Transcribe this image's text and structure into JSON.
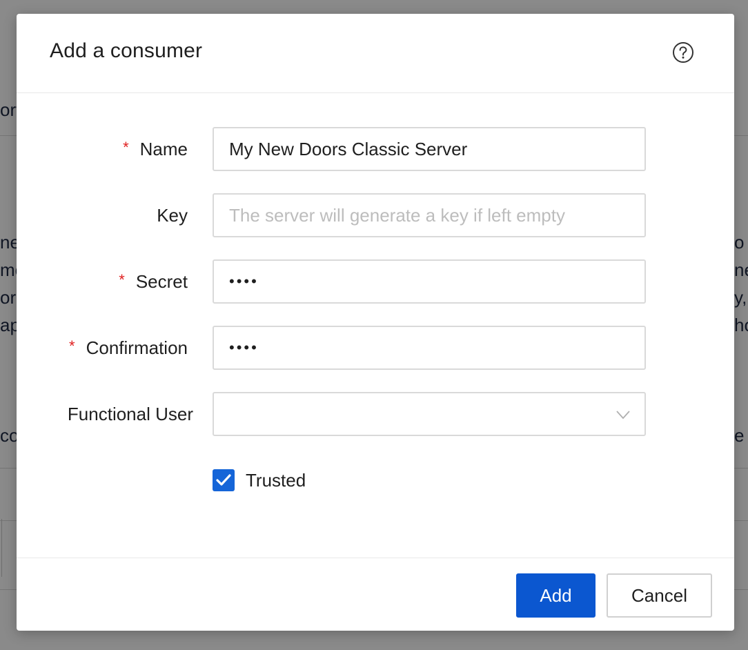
{
  "background": {
    "left_fragments": [
      "ort",
      "ne",
      "me",
      "or",
      "ap",
      "co"
    ],
    "right_fragments": [
      "o",
      "ne",
      "y,",
      "ho",
      "e"
    ]
  },
  "dialog": {
    "title": "Add a consumer",
    "help_icon": "question-circle-icon",
    "fields": {
      "name": {
        "label": "Name",
        "required_mark": "*",
        "value": "My New Doors Classic Server"
      },
      "key": {
        "label": "Key",
        "value": "",
        "placeholder": "The server will generate a key if left empty"
      },
      "secret": {
        "label": "Secret",
        "required_mark": "*",
        "value": "••••"
      },
      "confirmation": {
        "label": "Confirmation",
        "required_mark": "*",
        "value": "••••"
      },
      "functional_user": {
        "label": "Functional User",
        "value": "",
        "icon": "chevron-down-icon"
      }
    },
    "trusted": {
      "label": "Trusted",
      "checked": true
    },
    "footer": {
      "add_label": "Add",
      "cancel_label": "Cancel"
    }
  },
  "colors": {
    "primary": "#0b57d0",
    "required": "#e02020",
    "border": "#d9d9d9",
    "placeholder": "#bdbdbd"
  }
}
